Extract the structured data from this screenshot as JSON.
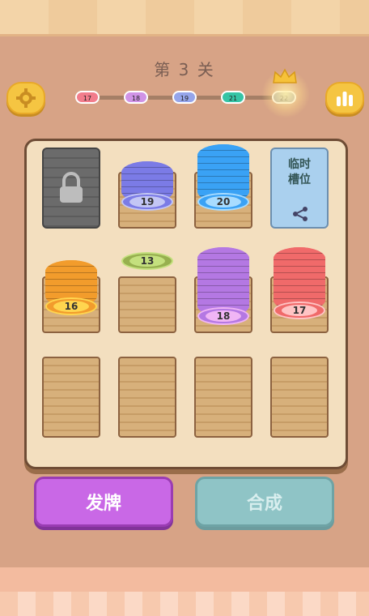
{
  "header": {
    "level_title": "第 3 关"
  },
  "toolbar": {
    "settings_icon": "gear-icon",
    "rank_icon": "bar-chart-icon"
  },
  "progress": {
    "levels": [
      {
        "label": "17",
        "color": "#f27d8c"
      },
      {
        "label": "18",
        "color": "#d093e6"
      },
      {
        "label": "19",
        "color": "#95a5ea"
      },
      {
        "label": "21",
        "color": "#35c4a5"
      },
      {
        "label": "22",
        "color": "#a8a8a8"
      }
    ],
    "goal_icon": "crown-icon"
  },
  "board": {
    "slots": [
      {
        "type": "locked",
        "icon": "lock-icon"
      },
      {
        "type": "stack",
        "number": "19",
        "color": "#7b7be6",
        "face": "#c3c6f5",
        "discs": 5
      },
      {
        "type": "stack",
        "number": "20",
        "color": "#3aa2f5",
        "face": "#a8dcff",
        "discs": 8
      },
      {
        "type": "temp",
        "label": "临时\n槽位",
        "icon": "share-icon"
      },
      {
        "type": "stack",
        "number": "16",
        "color": "#f29c2c",
        "face": "#ffd54f",
        "discs": 6
      },
      {
        "type": "stack",
        "number": "13",
        "color": "#97b04f",
        "face": "#c4e07e",
        "discs": 0
      },
      {
        "type": "stack",
        "number": "18",
        "color": "#b478e3",
        "face": "#f0b5f5",
        "discs": 10
      },
      {
        "type": "stack",
        "number": "17",
        "color": "#f06a6a",
        "face": "#ffc4c4",
        "discs": 9
      },
      {
        "type": "empty"
      },
      {
        "type": "empty"
      },
      {
        "type": "empty"
      },
      {
        "type": "empty"
      }
    ]
  },
  "actions": {
    "deal_label": "发牌",
    "merge_label": "合成"
  }
}
